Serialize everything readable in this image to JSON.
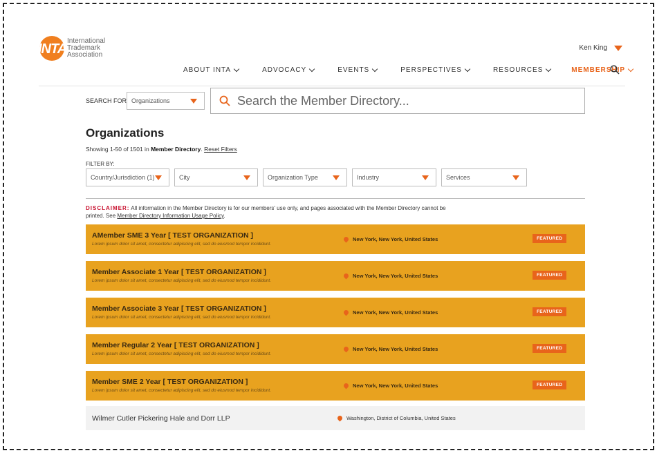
{
  "brand": {
    "logo_text": "INTA",
    "line1": "International",
    "line2": "Trademark",
    "line3": "Association"
  },
  "user": {
    "name": "Ken King"
  },
  "nav": [
    {
      "label": "ABOUT INTA",
      "active": false
    },
    {
      "label": "ADVOCACY",
      "active": false
    },
    {
      "label": "EVENTS",
      "active": false
    },
    {
      "label": "PERSPECTIVES",
      "active": false
    },
    {
      "label": "RESOURCES",
      "active": false
    },
    {
      "label": "MEMBERSHIP",
      "active": true
    }
  ],
  "search": {
    "label": "SEARCH FOR:",
    "scope": "Organizations",
    "placeholder": "Search the Member Directory..."
  },
  "results": {
    "title": "Organizations",
    "showing_prefix": "Showing 1-50 of 1501 in",
    "showing_source": "Member Directory",
    "reset": "Reset Filters",
    "filter_by": "FILTER BY:"
  },
  "filters": [
    {
      "label": "Country/Jurisdiction (1)"
    },
    {
      "label": "City"
    },
    {
      "label": "Organization Type"
    },
    {
      "label": "Industry"
    },
    {
      "label": "Services"
    }
  ],
  "disclaimer": {
    "label": "DISCLAIMER:",
    "text": " All information in the Member Directory is for our members' use only, and pages associated with the Member Directory cannot be printed. See ",
    "link": "Member Directory Information Usage Policy",
    "end": "."
  },
  "rows": [
    {
      "name": "AMember SME 3 Year [ TEST ORGANIZATION ]",
      "desc": "Lorem ipsum dolor sit amet, consectetur adipiscing elit, sed do eiusmod tempor incididunt.",
      "location": "New York, New York, United States",
      "badge": "FEATURED"
    },
    {
      "name": "Member Associate 1 Year [ TEST ORGANIZATION ]",
      "desc": "Lorem ipsum dolor sit amet, consectetur adipiscing elit, sed do eiusmod tempor incididunt.",
      "location": "New York, New York, United States",
      "badge": "FEATURED"
    },
    {
      "name": "Member Associate 3 Year [ TEST ORGANIZATION ]",
      "desc": "Lorem ipsum dolor sit amet, consectetur adipiscing elit, sed do eiusmod tempor incididunt.",
      "location": "New York, New York, United States",
      "badge": "FEATURED"
    },
    {
      "name": "Member Regular 2 Year [ TEST ORGANIZATION ]",
      "desc": "Lorem ipsum dolor sit amet, consectetur adipiscing elit, sed do eiusmod tempor incididunt.",
      "location": "New York, New York, United States",
      "badge": "FEATURED"
    },
    {
      "name": "Member SME 2 Year [ TEST ORGANIZATION ]",
      "desc": "Lorem ipsum dolor sit amet, consectetur adipiscing elit, sed do eiusmod tempor incididunt.",
      "location": "New York, New York, United States",
      "badge": "FEATURED"
    },
    {
      "name": "Wilmer Cutler Pickering Hale and Dorr LLP",
      "location": "Washington, District of Columbia, United States"
    }
  ],
  "colors": {
    "accent": "#e8641b",
    "featured_row": "#e8a21f",
    "plain_row": "#f2f2f2",
    "disclaimer": "#c8102e"
  }
}
